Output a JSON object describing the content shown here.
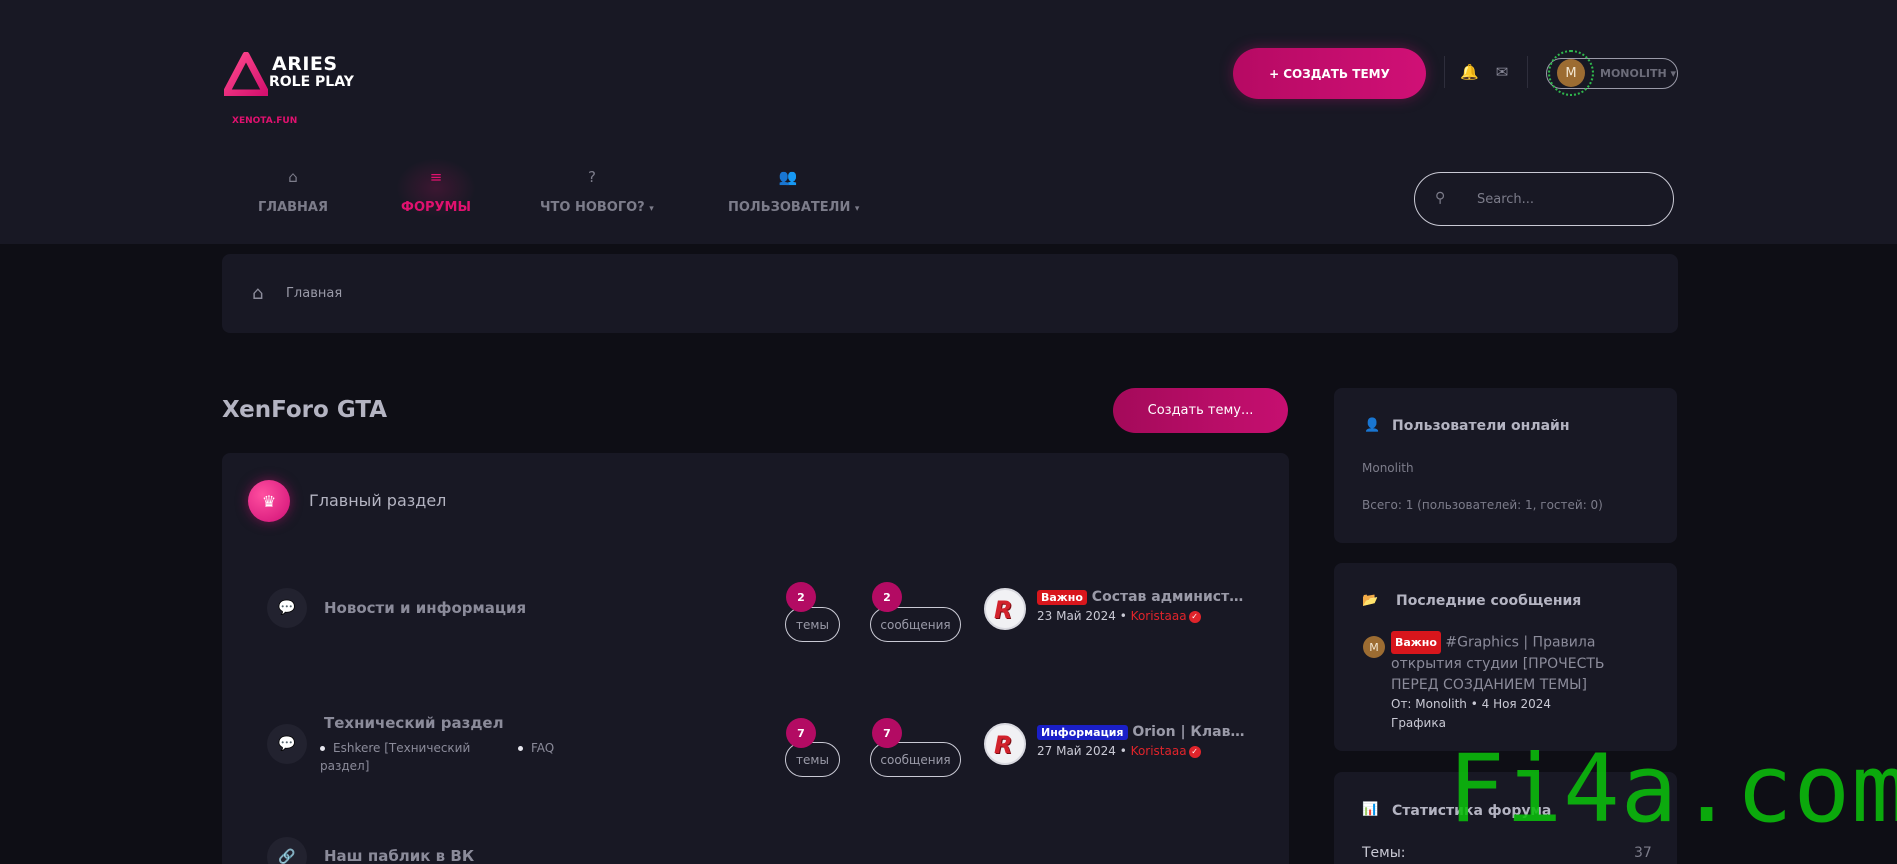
{
  "brand": {
    "line1": "ARIES",
    "line2": "ROLE PLAY",
    "site": "XENOTA.FUN",
    "accent": "#e0116f"
  },
  "header": {
    "create_thread": "СОЗДАТЬ ТЕМУ",
    "user_initial": "M",
    "user_name": "MONOLITH"
  },
  "nav": {
    "items": [
      {
        "label": "ГЛАВНАЯ",
        "icon": "home-icon"
      },
      {
        "label": "ФОРУМЫ",
        "icon": "list-icon"
      },
      {
        "label": "ЧТО НОВОГО?",
        "icon": "question-icon"
      },
      {
        "label": "ПОЛЬЗОВАТЕЛИ",
        "icon": "users-icon"
      }
    ],
    "search_placeholder": "Search..."
  },
  "breadcrumb": {
    "home": "Главная"
  },
  "main": {
    "title": "XenForo GTA",
    "create_button": "Создать тему...",
    "category": "Главный раздел",
    "nodes": [
      {
        "title": "Новости и информация",
        "threads": "2",
        "threads_label": "темы",
        "messages": "2",
        "messages_label": "сообщения",
        "prefix": "Важно",
        "last_title": "Состав администрации",
        "last_date": "23 Май 2024",
        "last_author": "Koristaaa"
      },
      {
        "title": "Технический раздел",
        "subforums": [
          "Eshkere [Технический раздел]",
          "FAQ"
        ],
        "threads": "7",
        "threads_label": "темы",
        "messages": "7",
        "messages_label": "сообщения",
        "prefix": "Информация",
        "last_title": "Orion | Клавиши",
        "last_date": "27 Май 2024",
        "last_author": "Koristaaa"
      },
      {
        "title": "Наш паблик в ВК"
      }
    ]
  },
  "sidebar": {
    "online": {
      "title": "Пользователи онлайн",
      "user": "Monolith",
      "total": "Всего: 1 (пользователей: 1, гостей: 0)"
    },
    "latest": {
      "title": "Последние сообщения",
      "avatar_initial": "M",
      "prefix": "Важно",
      "post_title": "#Graphics | Правила открытия студии [ПРОЧЕСТЬ ПЕРЕД СОЗДАНИЕМ ТЕМЫ]",
      "meta": "От: Monolith • 4 Ноя 2024",
      "forum": "Графика"
    },
    "stats": {
      "title": "Статистика форума",
      "threads_label": "Темы:",
      "threads_value": "37"
    }
  },
  "watermark": "Fi4a.com"
}
